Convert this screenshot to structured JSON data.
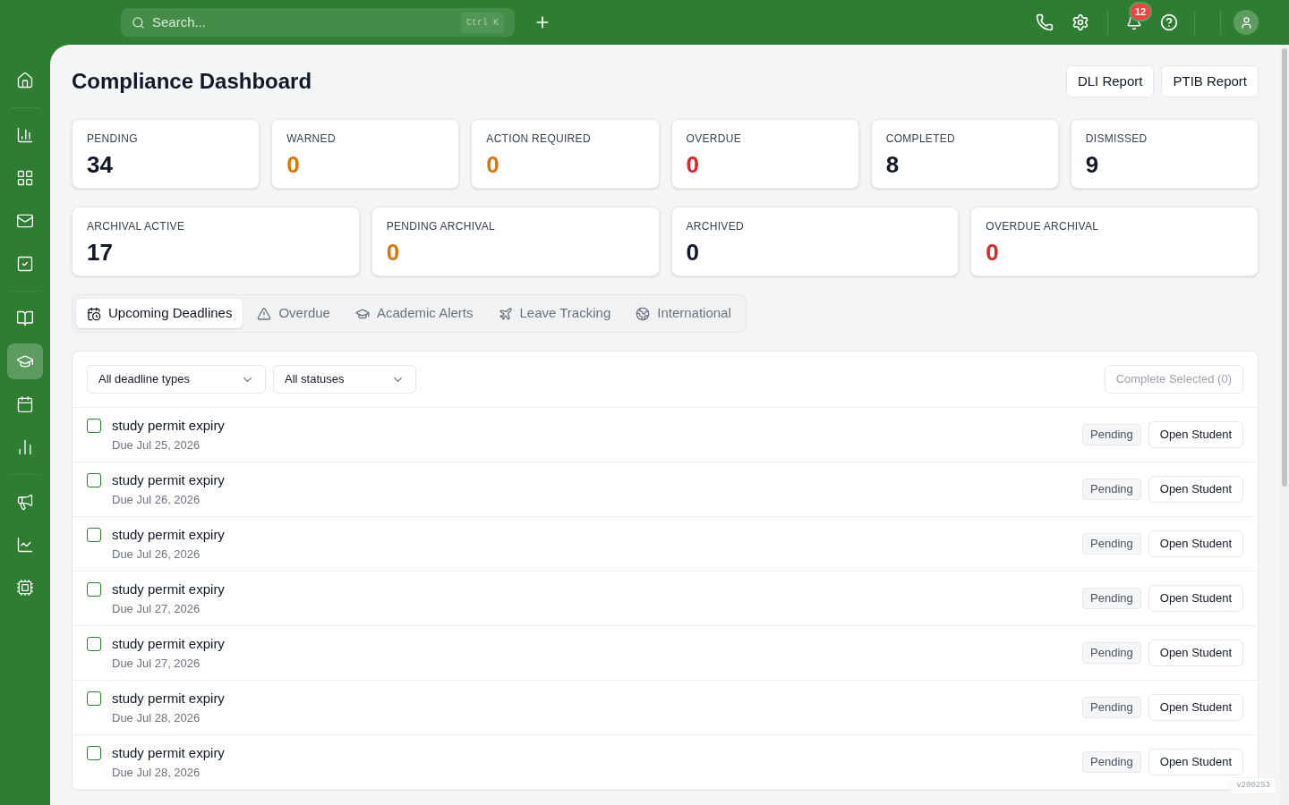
{
  "topbar": {
    "search": {
      "placeholder": "Search...",
      "shortcut": "Ctrl K"
    },
    "notifications": {
      "count": "12"
    }
  },
  "sidebar": {
    "groups": [
      {
        "items": [
          {
            "selected": false
          }
        ]
      },
      {
        "items": [
          {
            "selected": false
          },
          {
            "selected": false
          },
          {
            "selected": false
          },
          {
            "selected": false
          }
        ]
      },
      {
        "items": [
          {
            "selected": false
          },
          {
            "selected": true
          },
          {
            "selected": false
          },
          {
            "selected": false
          }
        ]
      },
      {
        "items": [
          {
            "selected": false
          },
          {
            "selected": false
          },
          {
            "selected": false
          }
        ]
      }
    ]
  },
  "header": {
    "title": "Compliance Dashboard",
    "buttons": [
      "DLI Report",
      "PTIB Report"
    ]
  },
  "stats_row_1": [
    {
      "label": "PENDING",
      "value": "34",
      "color": "#111827"
    },
    {
      "label": "WARNED",
      "value": "0",
      "color": "#d97706"
    },
    {
      "label": "ACTION REQUIRED",
      "value": "0",
      "color": "#d97706"
    },
    {
      "label": "OVERDUE",
      "value": "0",
      "color": "#dc2626"
    },
    {
      "label": "COMPLETED",
      "value": "8",
      "color": "#111827"
    },
    {
      "label": "DISMISSED",
      "value": "9",
      "color": "#111827"
    }
  ],
  "stats_row_2": [
    {
      "label": "ARCHIVAL ACTIVE",
      "value": "17",
      "color": "#111827"
    },
    {
      "label": "PENDING ARCHIVAL",
      "value": "0",
      "color": "#d97706"
    },
    {
      "label": "ARCHIVED",
      "value": "0",
      "color": "#111827"
    },
    {
      "label": "OVERDUE ARCHIVAL",
      "value": "0",
      "color": "#dc2626"
    }
  ],
  "tabs": [
    {
      "label": "Upcoming Deadlines",
      "selected": true
    },
    {
      "label": "Overdue",
      "selected": false
    },
    {
      "label": "Academic Alerts",
      "selected": false
    },
    {
      "label": "Leave Tracking",
      "selected": false
    },
    {
      "label": "International",
      "selected": false
    }
  ],
  "filters": [
    {
      "value": "All deadline types"
    },
    {
      "value": "All statuses"
    }
  ],
  "complete_button": {
    "label": "Complete Selected (0)",
    "disabled": true
  },
  "deadlines": [
    {
      "title": "study permit expiry",
      "due": "Due Jul 25, 2026",
      "status": "Pending",
      "checked": false,
      "action": "Open Student"
    },
    {
      "title": "study permit expiry",
      "due": "Due Jul 26, 2026",
      "status": "Pending",
      "checked": false,
      "action": "Open Student"
    },
    {
      "title": "study permit expiry",
      "due": "Due Jul 26, 2026",
      "status": "Pending",
      "checked": false,
      "action": "Open Student"
    },
    {
      "title": "study permit expiry",
      "due": "Due Jul 27, 2026",
      "status": "Pending",
      "checked": false,
      "action": "Open Student"
    },
    {
      "title": "study permit expiry",
      "due": "Due Jul 27, 2026",
      "status": "Pending",
      "checked": false,
      "action": "Open Student"
    },
    {
      "title": "study permit expiry",
      "due": "Due Jul 28, 2026",
      "status": "Pending",
      "checked": false,
      "action": "Open Student"
    },
    {
      "title": "study permit expiry",
      "due": "Due Jul 28, 2026",
      "status": "Pending",
      "checked": false,
      "action": "Open Student"
    }
  ],
  "version": "v200253"
}
